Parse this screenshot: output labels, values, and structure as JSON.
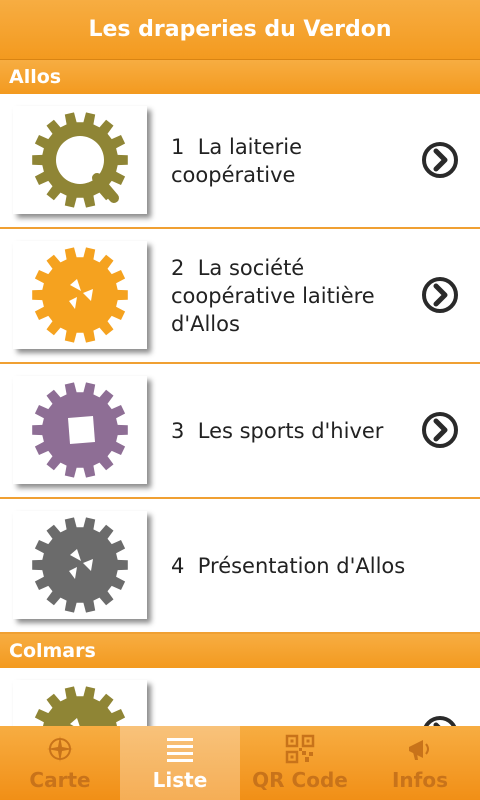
{
  "header": {
    "title": "Les draperies du Verdon"
  },
  "sections": [
    {
      "name": "Allos",
      "items": [
        {
          "number": "1",
          "title": "La laiterie coopérative",
          "icon": "magnifier-gear-icon",
          "color": "#8f8535",
          "has_arrow": true
        },
        {
          "number": "2",
          "title": "La société coopérative laitière d'Allos",
          "icon": "gear-icon",
          "color": "#f5a21f",
          "has_arrow": true
        },
        {
          "number": "3",
          "title": "Les sports d'hiver",
          "icon": "gear-icon",
          "color": "#8e6e95",
          "has_arrow": true
        },
        {
          "number": "4",
          "title": "Présentation d'Allos",
          "icon": "gear-icon",
          "color": "#6b6b6b",
          "has_arrow": false
        }
      ]
    },
    {
      "name": "Colmars",
      "items": [
        {
          "number": "",
          "title": "",
          "icon": "gear-icon",
          "color": "#8f8535",
          "has_arrow": true
        }
      ]
    }
  ],
  "tabs": [
    {
      "label": "Carte",
      "icon": "compass-icon",
      "active": false
    },
    {
      "label": "Liste",
      "icon": "list-icon",
      "active": true
    },
    {
      "label": "QR Code",
      "icon": "qr-code-icon",
      "active": false
    },
    {
      "label": "Infos",
      "icon": "megaphone-icon",
      "active": false
    }
  ]
}
